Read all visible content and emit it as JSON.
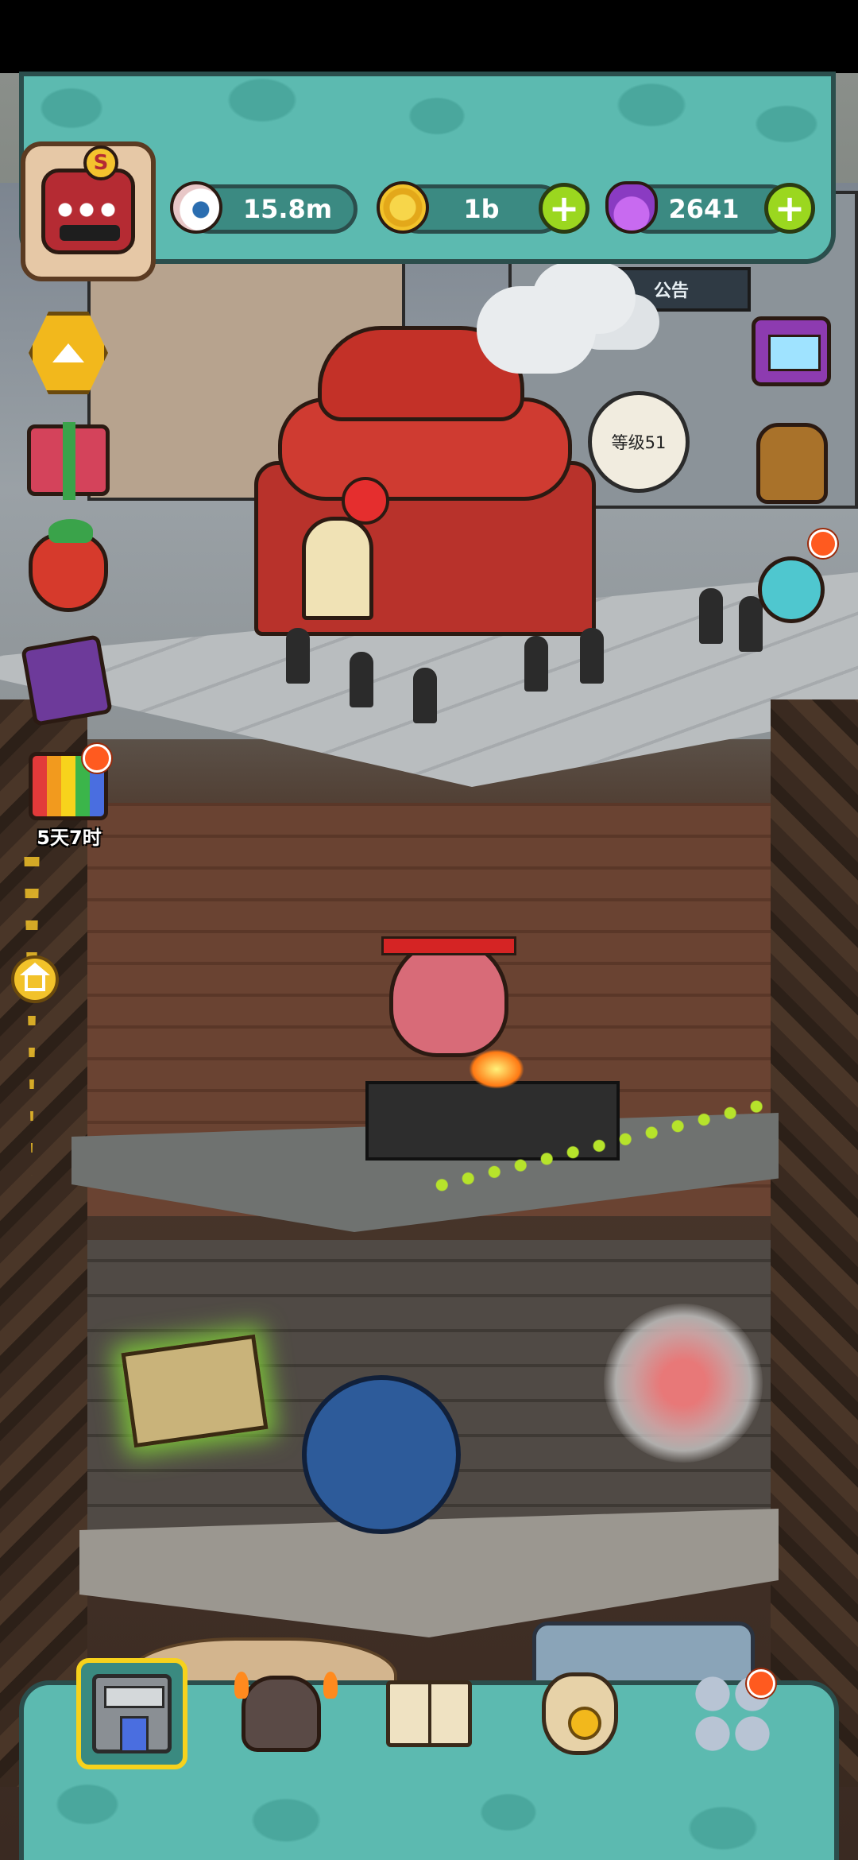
{
  "hud": {
    "eyeballs": {
      "icon": "eyeball-icon",
      "value": "15.8m"
    },
    "coins": {
      "icon": "coin-icon",
      "value": "1b",
      "add": "+"
    },
    "potions": {
      "icon": "potion-icon",
      "value": "2641",
      "add": "+"
    },
    "avatar": {
      "rank_letter": "S",
      "icon": "monster-avatar-icon"
    }
  },
  "scene": {
    "notice_sign": "公告",
    "level_bubble": "等级51"
  },
  "side": {
    "up_icon": "triangle-up-icon",
    "limited_gift_timer": "5天7时",
    "home_icon": "home-icon"
  },
  "nav": {
    "items": [
      {
        "name": "shop",
        "icon": "shop-building-icon",
        "active": true
      },
      {
        "name": "monsters",
        "icon": "monster-icon",
        "active": false
      },
      {
        "name": "recipe-book",
        "icon": "book-icon",
        "active": false
      },
      {
        "name": "money-bag",
        "icon": "money-bag-icon",
        "active": false
      },
      {
        "name": "more",
        "icon": "grid-icon",
        "active": false,
        "badge": true
      }
    ]
  },
  "colors": {
    "hud_teal": "#5cbab0",
    "plus_green": "#9bd71f",
    "badge_red": "#ff5a1f",
    "active_yellow": "#f7d21c"
  }
}
